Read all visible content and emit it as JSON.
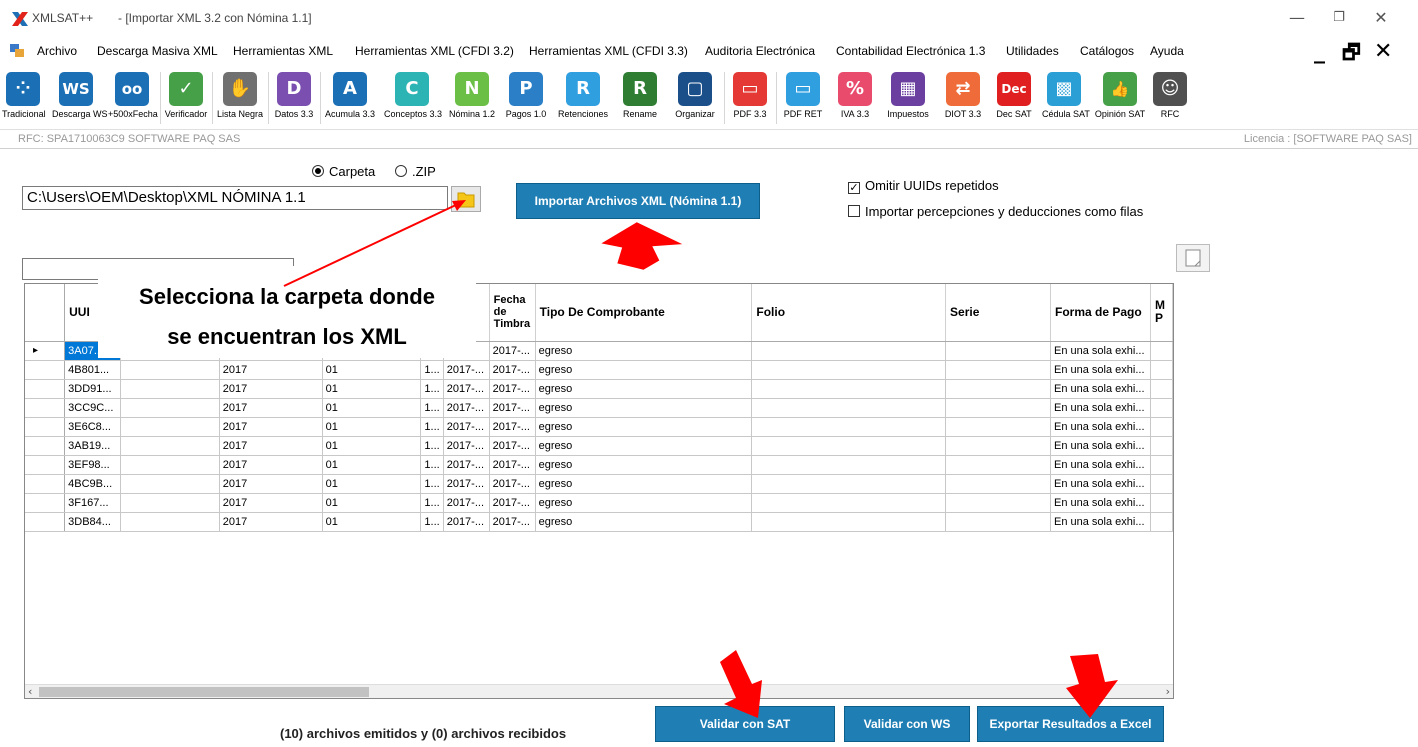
{
  "window": {
    "app_name": "XMLSAT++",
    "doc_title": "- [Importar XML 3.2 con  Nómina 1.1]",
    "minimize": "—",
    "maximize": "❐",
    "close": "✕"
  },
  "menu": {
    "items": [
      "Archivo",
      "Descarga Masiva XML",
      "Herramientas XML",
      "Herramientas XML (CFDI 3.2)",
      "Herramientas XML (CFDI 3.3)",
      "Auditoria Electrónica",
      "Contabilidad Electrónica 1.3",
      "Utilidades",
      "Catálogos",
      "Ayuda"
    ],
    "mdi_min": "_",
    "mdi_restore": "🗗",
    "mdi_close": "✕"
  },
  "toolbar": [
    {
      "label": "Tradicional",
      "glyph": "⁘",
      "color": "#1a6fb5"
    },
    {
      "label": "Descarga WS",
      "glyph": "WS",
      "color": "#1a6fb5"
    },
    {
      "label": "+500xFecha",
      "glyph": "oo",
      "color": "#1a6fb5"
    },
    {
      "label": "Verificador",
      "glyph": "✓",
      "color": "#45a047"
    },
    {
      "label": "Lista Negra",
      "glyph": "✋",
      "color": "#707070"
    },
    {
      "label": "Datos 3.3",
      "glyph": "D",
      "color": "#7a4fb0"
    },
    {
      "label": "Acumula 3.3",
      "glyph": "A",
      "color": "#1a6fb5"
    },
    {
      "label": "Conceptos 3.3",
      "glyph": "C",
      "color": "#2cb3b3"
    },
    {
      "label": "Nómina 1.2",
      "glyph": "N",
      "color": "#6bbf47"
    },
    {
      "label": "Pagos 1.0",
      "glyph": "P",
      "color": "#2b7fc7"
    },
    {
      "label": "Retenciones",
      "glyph": "R",
      "color": "#2f9fe0"
    },
    {
      "label": "Rename",
      "glyph": "R",
      "color": "#2e7d32"
    },
    {
      "label": "Organizar",
      "glyph": "▢",
      "color": "#1a4f8a"
    },
    {
      "label": "PDF 3.3",
      "glyph": "▭",
      "color": "#e53935"
    },
    {
      "label": "PDF RET",
      "glyph": "▭",
      "color": "#2f9fe0"
    },
    {
      "label": "IVA 3.3",
      "glyph": "%",
      "color": "#e94b6d"
    },
    {
      "label": "Impuestos",
      "glyph": "▦",
      "color": "#6a3fa0"
    },
    {
      "label": "DIOT 3.3",
      "glyph": "⇄",
      "color": "#ef6c3a"
    },
    {
      "label": "Dec SAT",
      "glyph": "Dec",
      "color": "#e02020"
    },
    {
      "label": "Cédula SAT",
      "glyph": "▩",
      "color": "#2a9fd6"
    },
    {
      "label": "Opinión SAT",
      "glyph": "👍",
      "color": "#45a047"
    },
    {
      "label": "RFC",
      "glyph": "☺",
      "color": "#505050"
    }
  ],
  "status": {
    "rfc": "RFC: SPA1710063C9 SOFTWARE PAQ SAS",
    "license": "Licencia : [SOFTWARE PAQ SAS]"
  },
  "form": {
    "radio_folder": "Carpeta",
    "radio_zip": ".ZIP",
    "path": "C:\\Users\\OEM\\Desktop\\XML NÓMINA 1.1",
    "import_button": "Importar Archivos  XML (Nómina 1.1)",
    "omit_uuids": "Omitir UUIDs repetidos",
    "import_rows": "Importar percepciones y deducciones como filas"
  },
  "grid": {
    "columns": [
      "UUI",
      "",
      "",
      "",
      "",
      "Fecha de Timbra",
      "Tipo De Comprobante",
      "Folio",
      "Serie",
      "Forma de Pago",
      "M P"
    ],
    "rows": [
      [
        "3A07...",
        "",
        "",
        "",
        "",
        "2017-...",
        "egreso",
        "",
        "",
        "En una sola exhi..."
      ],
      [
        "4B801...",
        "",
        "2017",
        "01",
        "1...",
        "2017-...",
        "egreso",
        "",
        "",
        "En una sola exhi..."
      ],
      [
        "3DD91...",
        "",
        "2017",
        "01",
        "1...",
        "2017-...",
        "egreso",
        "",
        "",
        "En una sola exhi..."
      ],
      [
        "3CC9C...",
        "",
        "2017",
        "01",
        "1...",
        "2017-...",
        "egreso",
        "",
        "",
        "En una sola exhi..."
      ],
      [
        "3E6C8...",
        "",
        "2017",
        "01",
        "1...",
        "2017-...",
        "egreso",
        "",
        "",
        "En una sola exhi..."
      ],
      [
        "3AB19...",
        "",
        "2017",
        "01",
        "1...",
        "2017-...",
        "egreso",
        "",
        "",
        "En una sola exhi..."
      ],
      [
        "3EF98...",
        "",
        "2017",
        "01",
        "1...",
        "2017-...",
        "egreso",
        "",
        "",
        "En una sola exhi..."
      ],
      [
        "4BC9B...",
        "",
        "2017",
        "01",
        "1...",
        "2017-...",
        "egreso",
        "",
        "",
        "En una sola exhi..."
      ],
      [
        "3F167...",
        "",
        "2017",
        "01",
        "1...",
        "2017-...",
        "egreso",
        "",
        "",
        "En una sola exhi..."
      ],
      [
        "3DB84...",
        "",
        "2017",
        "01",
        "1...",
        "2017-...",
        "egreso",
        "",
        "",
        "En una sola exhi..."
      ]
    ],
    "fecha_col_cell": "2017-..."
  },
  "annotation": {
    "line1": "Selecciona la carpeta donde",
    "line2": "se encuentran los XML",
    "color": "#ff0000"
  },
  "footer": {
    "summary": "(10) archivos emitidos y (0) archivos recibidos",
    "validate_sat": "Validar con SAT",
    "validate_ws": "Validar con WS",
    "export_excel": "Exportar Resultados  a Excel"
  }
}
